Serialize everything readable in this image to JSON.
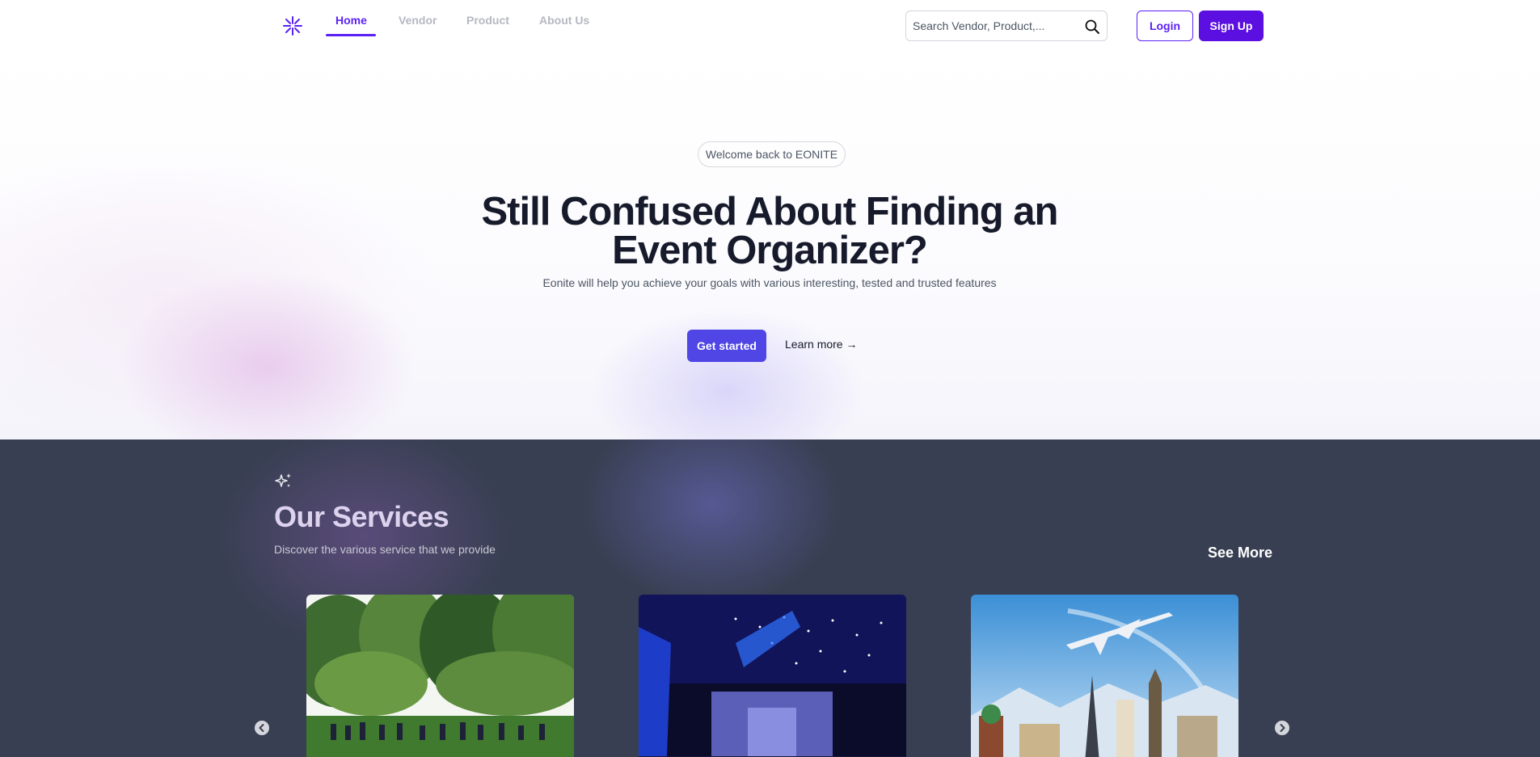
{
  "nav": {
    "logo_icon": "snowflake-logo-icon",
    "links": [
      {
        "label": "Home",
        "active": true
      },
      {
        "label": "Vendor",
        "active": false
      },
      {
        "label": "Product",
        "active": false
      },
      {
        "label": "About Us",
        "active": false
      }
    ],
    "search_placeholder": "Search Vendor, Product,...",
    "search_icon": "search-icon",
    "login_label": "Login",
    "signup_label": "Sign Up"
  },
  "hero": {
    "badge": "Welcome back to EONITE",
    "title_line1": "Still Confused About Finding an",
    "title_line2": "Event Organizer?",
    "subtitle": "Eonite will help you achieve your goals with various interesting, tested and trusted features",
    "cta_primary": "Get started",
    "cta_secondary": "Learn more →"
  },
  "services": {
    "icon": "sparkles-icon",
    "title": "Our Services",
    "subtitle": "Discover the various service that we provide",
    "see_more": "See More",
    "cards": [
      {
        "image": "outdoor-garden-event-photo"
      },
      {
        "image": "concert-hall-stage-photo"
      },
      {
        "image": "travel-landmarks-airplane-photo"
      }
    ],
    "prev_icon": "chevron-left-circle-icon",
    "next_icon": "chevron-right-circle-icon"
  },
  "colors": {
    "brand": "#5b21f5",
    "primary_button": "#4f46e5",
    "services_bg": "#383f52"
  }
}
